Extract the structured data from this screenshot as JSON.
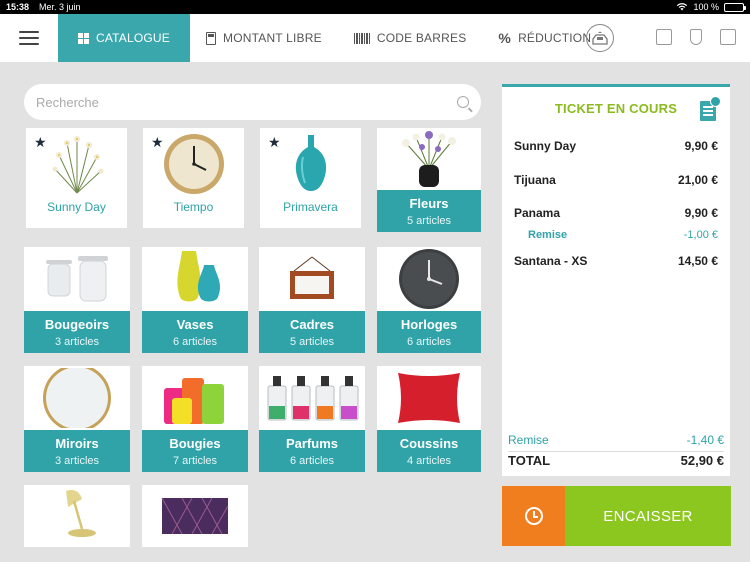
{
  "statusbar": {
    "time": "15:38",
    "date": "Mer. 3 juin",
    "battery": "100 %"
  },
  "nav": {
    "tabs": [
      {
        "label": "CATALOGUE",
        "icon": "grid-icon",
        "active": true
      },
      {
        "label": "MONTANT LIBRE",
        "icon": "calculator-icon"
      },
      {
        "label": "CODE BARRES",
        "icon": "barcode-icon"
      },
      {
        "label": "RÉDUCTION",
        "icon": "percent-icon"
      }
    ]
  },
  "search": {
    "placeholder": "Recherche"
  },
  "products": [
    {
      "name": "Sunny Day",
      "favorite": true,
      "icon": "flowers-image"
    },
    {
      "name": "Tiempo",
      "favorite": true,
      "icon": "clock-image"
    },
    {
      "name": "Primavera",
      "favorite": true,
      "icon": "vase-image"
    }
  ],
  "categories": [
    {
      "name": "Fleurs",
      "count": "5 articles"
    },
    {
      "name": "Bougeoirs",
      "count": "3 articles"
    },
    {
      "name": "Vases",
      "count": "6 articles"
    },
    {
      "name": "Cadres",
      "count": "5 articles"
    },
    {
      "name": "Horloges",
      "count": "6 articles"
    },
    {
      "name": "Miroirs",
      "count": "3 articles"
    },
    {
      "name": "Bougies",
      "count": "7 articles"
    },
    {
      "name": "Parfums",
      "count": "6 articles"
    },
    {
      "name": "Coussins",
      "count": "4 articles"
    }
  ],
  "ticket": {
    "title": "TICKET EN COURS",
    "lines": [
      {
        "name": "Sunny Day",
        "amount": "9,90 €"
      },
      {
        "name": "Tijuana",
        "amount": "21,00 €"
      },
      {
        "name": "Panama",
        "amount": "9,90 €"
      },
      {
        "name": "Remise",
        "amount": "-1,00 €"
      },
      {
        "name": "Santana - XS",
        "amount": "14,50 €"
      }
    ],
    "remise_label": "Remise",
    "remise_amount": "-1,40 €",
    "total_label": "TOTAL",
    "total_amount": "52,90 €"
  },
  "actions": {
    "pay_label": "ENCAISSER"
  },
  "colors": {
    "teal": "#2fa3a8",
    "green": "#8cc71f",
    "orange": "#f07d1e",
    "title_green": "#8cbb1f"
  }
}
